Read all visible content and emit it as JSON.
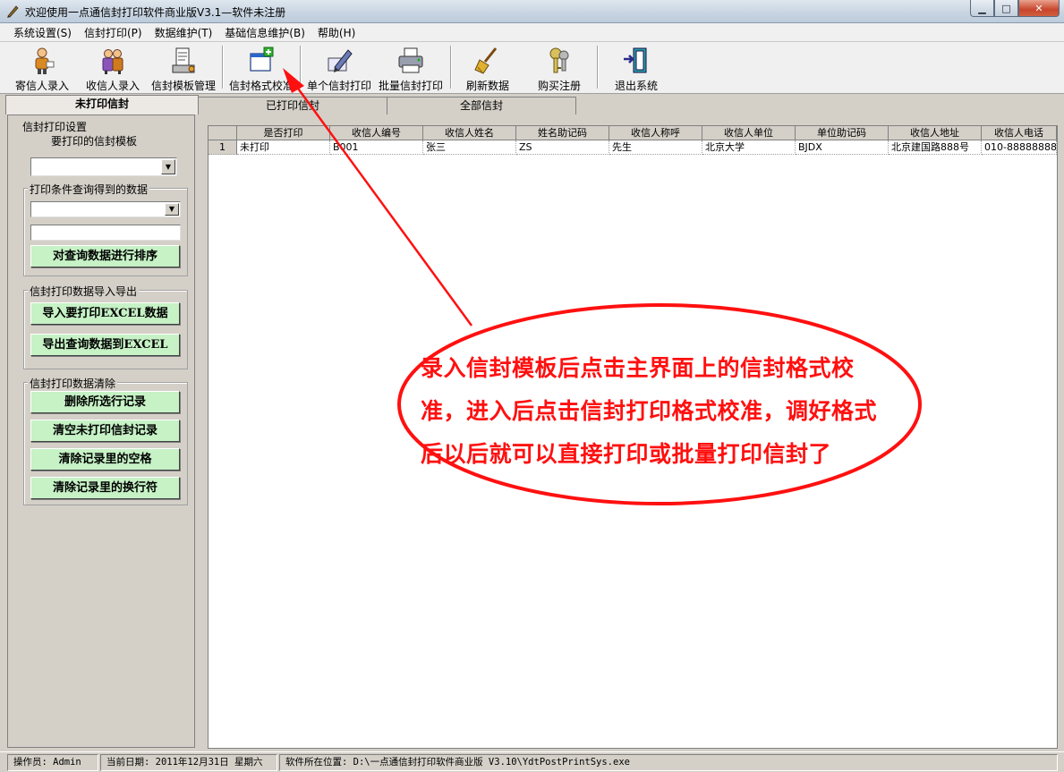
{
  "window": {
    "title": "欢迎使用一点通信封打印软件商业版V3.1—软件未注册",
    "minimize_glyph": "▁",
    "maximize_glyph": "□",
    "close_glyph": "✕"
  },
  "menu": [
    "系统设置(S)",
    "信封打印(P)",
    "数据维护(T)",
    "基础信息维护(B)",
    "帮助(H)"
  ],
  "toolbar": [
    {
      "label": "寄信人录入",
      "icon": "sender-person-icon"
    },
    {
      "label": "收信人录入",
      "icon": "recipient-people-icon"
    },
    {
      "label": "信封模板管理",
      "icon": "template-printer-icon"
    },
    {
      "label": "信封格式校准",
      "icon": "window-add-icon"
    },
    {
      "label": "单个信封打印",
      "icon": "pen-edit-icon"
    },
    {
      "label": "批量信封打印",
      "icon": "printer-icon"
    },
    {
      "label": "刷新数据",
      "icon": "broom-icon"
    },
    {
      "label": "购买注册",
      "icon": "keys-icon"
    },
    {
      "label": "退出系统",
      "icon": "exit-door-icon"
    }
  ],
  "tabs": [
    "未打印信封",
    "已打印信封",
    "全部信封"
  ],
  "left_panel": {
    "group1_title": "信封打印设置",
    "template_label": "要打印的信封模板",
    "template_value": "",
    "query_group_title": "打印条件查询得到的数据",
    "query_combo_value": "",
    "query_text_value": "",
    "sort_button": "对查询数据进行排序",
    "io_group_title": "信封打印数据导入导出",
    "import_button": "导入要打印EXCEL数据",
    "export_button": "导出查询数据到EXCEL",
    "clear_group_title": "信封打印数据清除",
    "delete_button": "删除所选行记录",
    "clear_unprinted_button": "清空未打印信封记录",
    "clear_spaces_button": "清除记录里的空格",
    "clear_newlines_button": "清除记录里的换行符"
  },
  "grid": {
    "columns": [
      "是否打印",
      "收信人编号",
      "收信人姓名",
      "姓名助记码",
      "收信人称呼",
      "收信人单位",
      "单位助记码",
      "收信人地址",
      "收信人电话"
    ],
    "rows": [
      {
        "num": "1",
        "cells": [
          "未打印",
          "B001",
          "张三",
          "ZS",
          "先生",
          "北京大学",
          "BJDX",
          "北京建国路888号",
          "010-88888888"
        ]
      }
    ]
  },
  "status": {
    "operator": "操作员: Admin",
    "date": "当前日期: 2011年12月31日 星期六",
    "location": "软件所在位置: D:\\一点通信封打印软件商业版 V3.10\\YdtPostPrintSys.exe"
  },
  "annotation": {
    "text": "录入信封模板后点击主界面上的信封格式校准，进入后点击信封打印格式校准，调好格式后以后就可以直接打印或批量打印信封了",
    "color": "#ff1010"
  },
  "colors": {
    "button_green": "#c6f2c6",
    "face": "#d4d0c8"
  }
}
